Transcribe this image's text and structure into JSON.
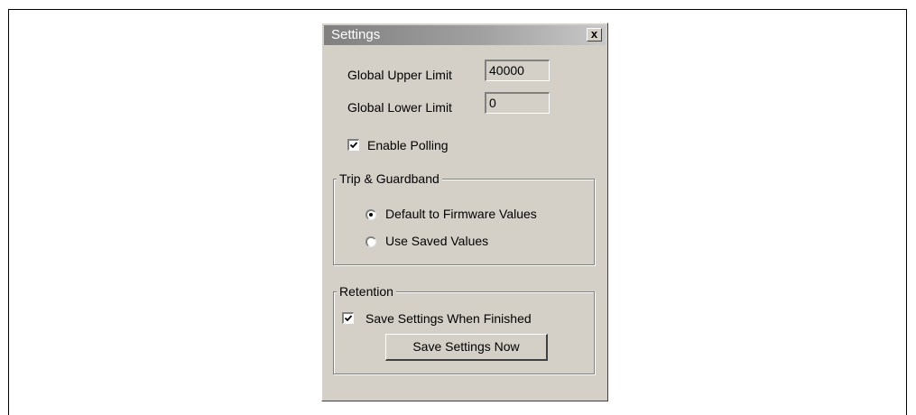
{
  "window": {
    "title": "Settings",
    "close_glyph": "x"
  },
  "limits": {
    "upper_label": "Global Upper Limit",
    "upper_value": "40000",
    "lower_label": "Global Lower Limit",
    "lower_value": "0"
  },
  "polling": {
    "label": "Enable Polling",
    "checked": true
  },
  "trip_guardband": {
    "title": "Trip & Guardband",
    "options": [
      {
        "label": "Default to Firmware Values",
        "selected": true
      },
      {
        "label": "Use Saved Values",
        "selected": false
      }
    ]
  },
  "retention": {
    "title": "Retention",
    "save_when_finished_label": "Save Settings When Finished",
    "save_when_finished_checked": true,
    "save_now_label": "Save Settings Now"
  },
  "icons": {
    "close": "close-icon",
    "check": "checkmark-icon",
    "radio": "radio-dot-icon"
  }
}
